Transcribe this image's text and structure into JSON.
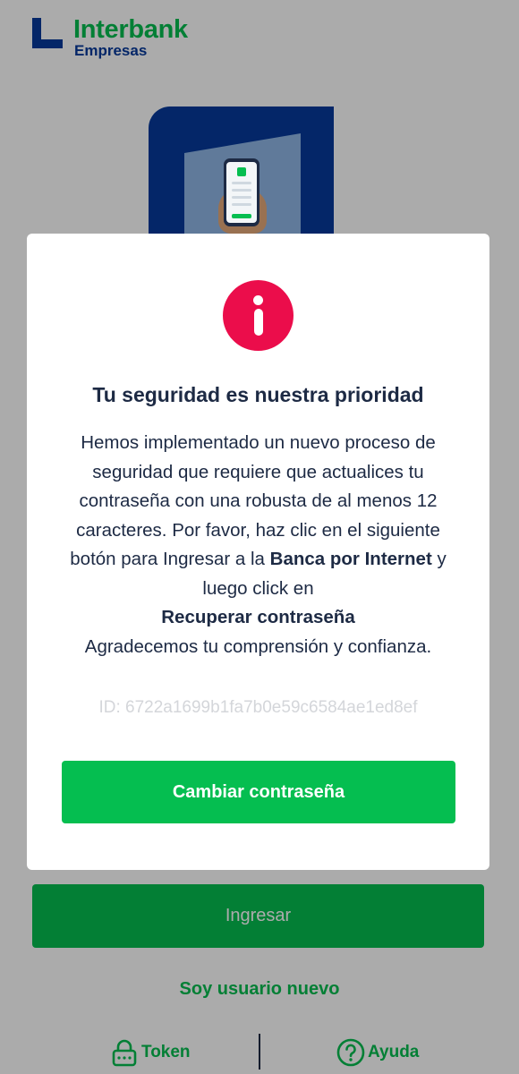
{
  "brand": {
    "name": "Interbank",
    "sub": "Empresas",
    "primary_green": "#05be50",
    "brand_blue": "#063a9b"
  },
  "hero": {
    "icon": "phone-in-hand-illustration"
  },
  "background": {
    "ingresar_label": "Ingresar",
    "new_user_label": "Soy usuario nuevo",
    "nav": {
      "token_label": "Token",
      "token_icon": "lock-icon",
      "help_label": "Ayuda",
      "help_icon": "question-circle-icon"
    }
  },
  "modal": {
    "icon": "info-icon",
    "icon_color": "#eb0d4b",
    "title": "Tu seguridad es nuestra prioridad",
    "body_part1": "Hemos implementado un nuevo proceso de seguridad que requiere que actualices tu contraseña con una robusta de al menos 12 caracteres. Por favor, haz clic en el siguiente botón para Ingresar a la",
    "body_bold1": "Banca por Internet",
    "body_part2": "y luego click en",
    "body_bold2": "Recuperar contraseña",
    "body_part3": "Agradecemos tu comprensión y confianza.",
    "id_text": "ID: 6722a1699b1fa7b0e59c6584ae1ed8ef",
    "button_label": "Cambiar contraseña"
  }
}
